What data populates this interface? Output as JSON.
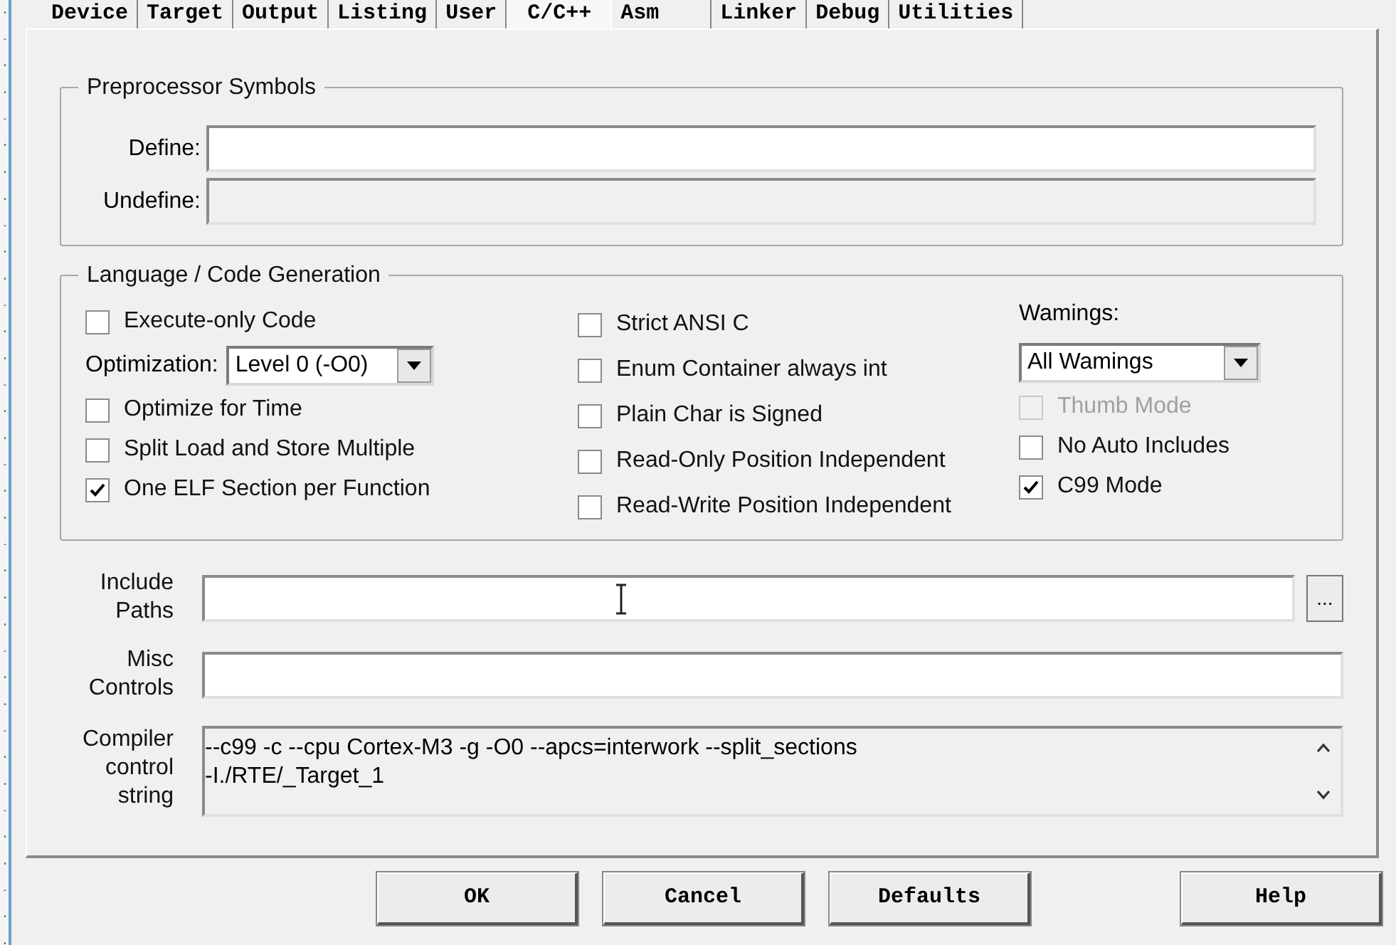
{
  "tabs": [
    {
      "label": "Device",
      "selected": false
    },
    {
      "label": "Target",
      "selected": false
    },
    {
      "label": "Output",
      "selected": false
    },
    {
      "label": "Listing",
      "selected": false
    },
    {
      "label": "User",
      "selected": false
    },
    {
      "label": "C/C++",
      "selected": true
    },
    {
      "label": "Asm",
      "selected": false
    },
    {
      "label": "Linker",
      "selected": false
    },
    {
      "label": "Debug",
      "selected": false
    },
    {
      "label": "Utilities",
      "selected": false
    }
  ],
  "preprocessor": {
    "title": "Preprocessor Symbols",
    "define": {
      "label": "Define:",
      "disabled": false
    },
    "undefine": {
      "label": "Undefine:",
      "disabled": true
    }
  },
  "language": {
    "title": "Language / Code Generation",
    "column_1": [
      {
        "kind": "checkbox",
        "label": "Execute-only Code",
        "checked": false,
        "disabled": false
      },
      {
        "kind": "select",
        "label": "Optimization:",
        "value": "Level 0 (-O0)"
      },
      {
        "kind": "checkbox",
        "label": "Optimize for Time",
        "checked": false,
        "disabled": false
      },
      {
        "kind": "checkbox",
        "label": "Split Load and Store Multiple",
        "checked": false,
        "disabled": false
      },
      {
        "kind": "checkbox",
        "label": "One ELF Section per Function",
        "checked": true,
        "disabled": false
      }
    ],
    "column_2": [
      {
        "kind": "checkbox",
        "label": "Strict ANSI C",
        "checked": false,
        "disabled": false
      },
      {
        "kind": "checkbox",
        "label": "Enum Container always int",
        "checked": false,
        "disabled": false
      },
      {
        "kind": "checkbox",
        "label": "Plain Char is Signed",
        "checked": false,
        "disabled": false
      },
      {
        "kind": "checkbox",
        "label": "Read-Only Position Independent",
        "checked": false,
        "disabled": false
      },
      {
        "kind": "checkbox",
        "label": "Read-Write Position Independent",
        "checked": false,
        "disabled": false
      }
    ],
    "column_3": [
      {
        "kind": "label",
        "label": "Wamings:"
      },
      {
        "kind": "select",
        "value": "All Wamings"
      },
      {
        "kind": "checkbox",
        "label": "Thumb Mode",
        "checked": false,
        "disabled": true
      },
      {
        "kind": "checkbox",
        "label": "No Auto Includes",
        "checked": false,
        "disabled": false
      },
      {
        "kind": "checkbox",
        "label": "C99 Mode",
        "checked": true,
        "disabled": false
      }
    ]
  },
  "include_paths": {
    "label_lines": [
      "Include",
      "Paths"
    ],
    "browse": "..."
  },
  "misc_controls": {
    "label_lines": [
      "Misc",
      "Controls"
    ]
  },
  "compiler_control_string": {
    "label_lines": [
      "Compiler",
      "control",
      "string"
    ],
    "lines": [
      "--c99 -c --cpu Cortex-M3 -g -O0 --apcs=interwork --split_sections",
      "-I./RTE/_Target_1"
    ]
  },
  "buttons": [
    "OK",
    "Cancel",
    "Defaults",
    "Help"
  ]
}
